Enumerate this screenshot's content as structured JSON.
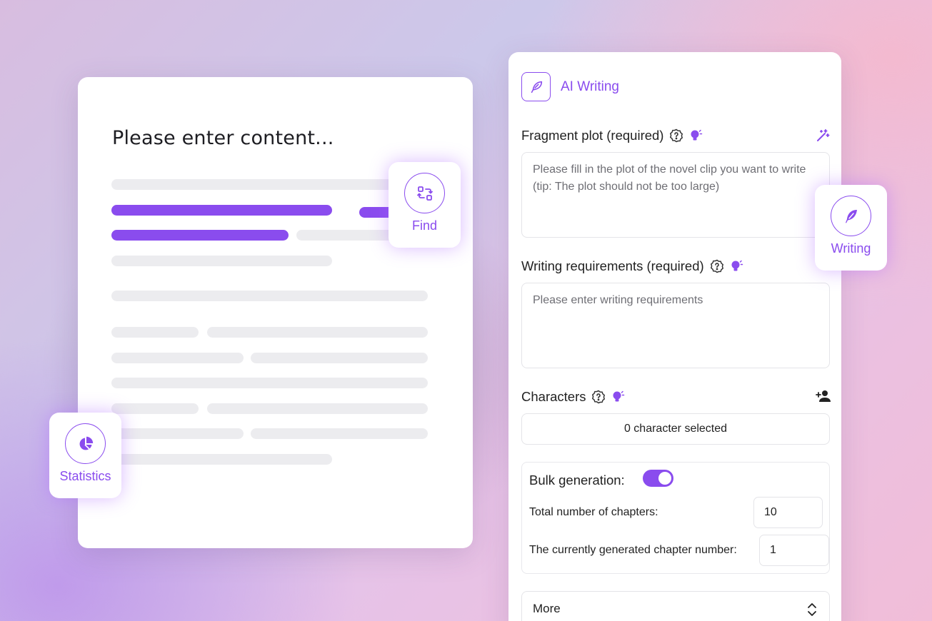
{
  "editor": {
    "title": "Please enter content..."
  },
  "tools": {
    "find_label": "Find",
    "statistics_label": "Statistics",
    "writing_label": "Writing"
  },
  "panel": {
    "title": "AI Writing",
    "fragment_plot": {
      "label": "Fragment plot (required)",
      "placeholder": "Please fill in the plot of the novel clip you want to write (tip: The plot should not be too large)"
    },
    "writing_requirements": {
      "label": "Writing requirements (required)",
      "placeholder": "Please enter writing requirements"
    },
    "characters": {
      "label": "Characters",
      "selected_text": "0 character selected"
    },
    "bulk": {
      "label": "Bulk generation:",
      "enabled": true,
      "total_chapters_label": "Total number of chapters:",
      "total_chapters_value": "10",
      "current_chapter_label": "The currently generated chapter number:",
      "current_chapter_value": "1"
    },
    "more_label": "More"
  },
  "colors": {
    "accent": "#8a4cee",
    "skeleton": "#ececef"
  },
  "icons": [
    "feather-icon",
    "help-icon",
    "bulb-icon",
    "magic-wand-icon",
    "add-person-icon",
    "swap-icon",
    "pie-chart-icon",
    "chevron-up-down-icon"
  ]
}
